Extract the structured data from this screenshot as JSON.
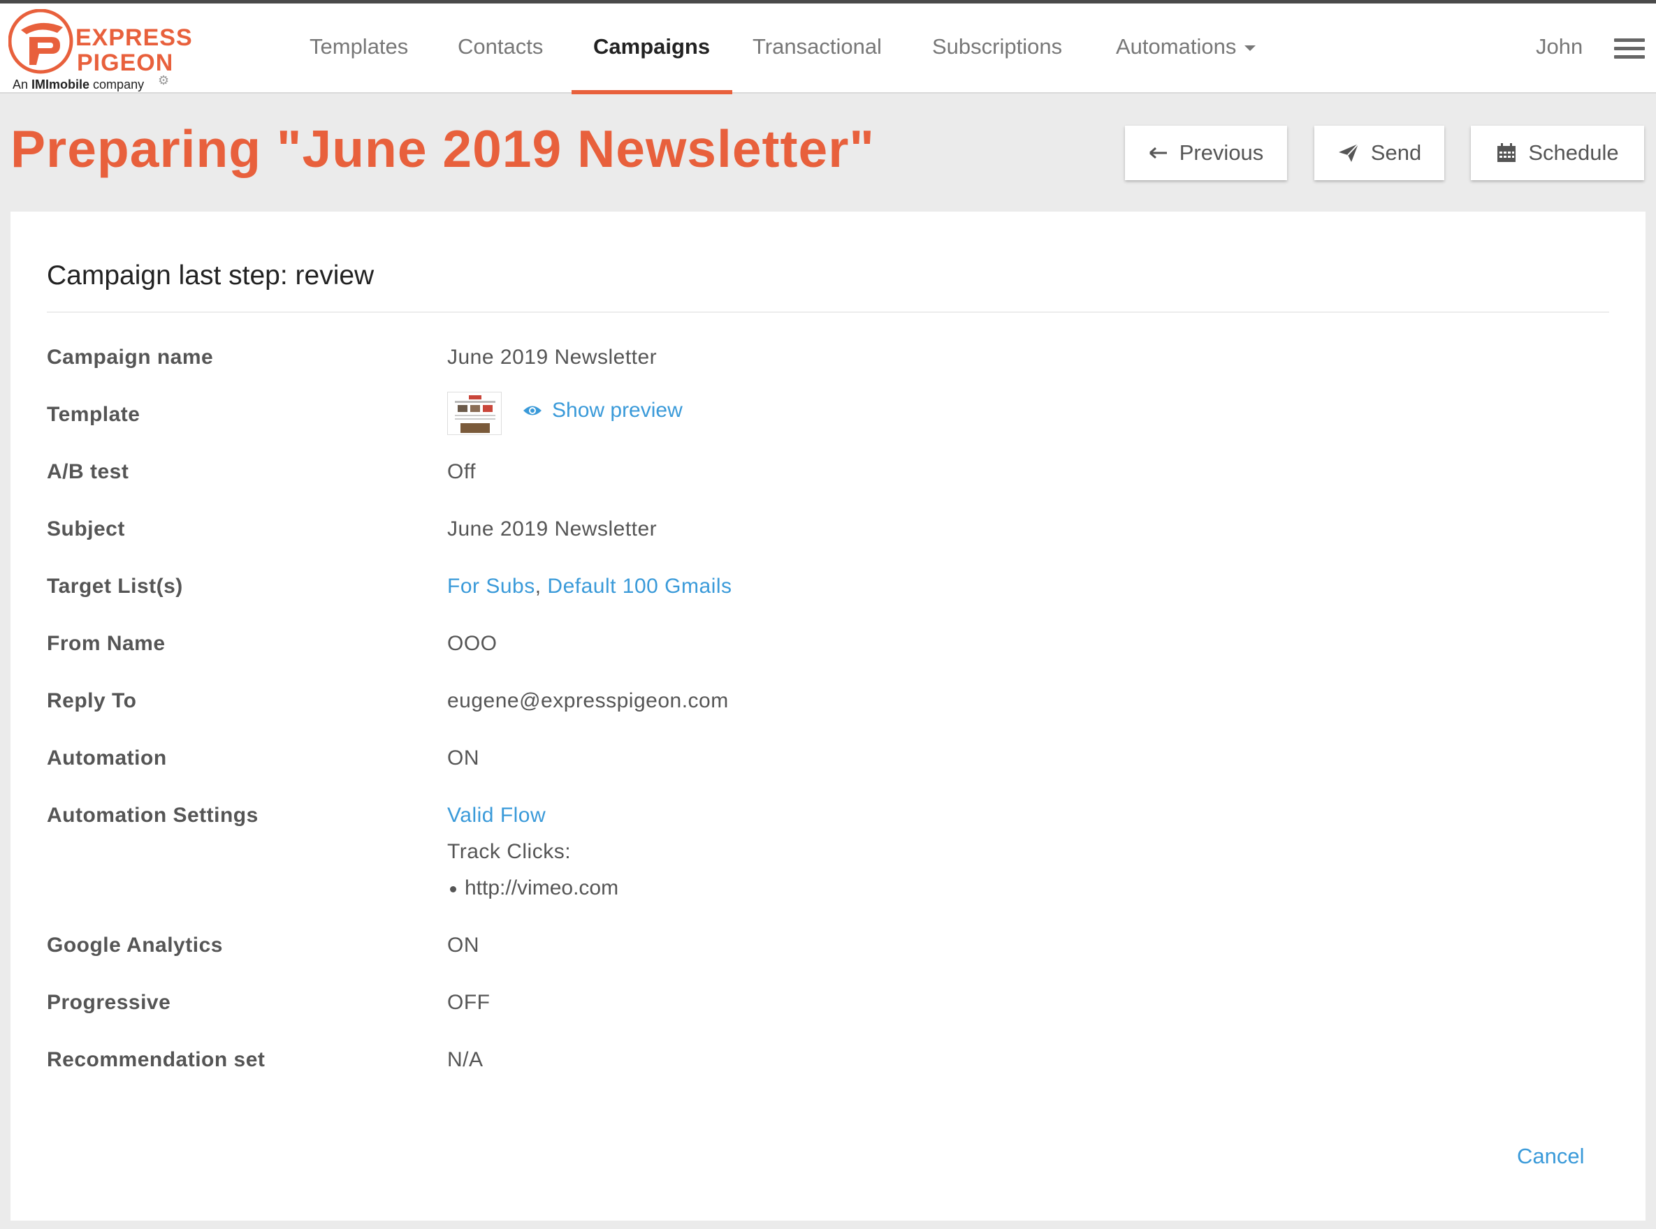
{
  "brand": {
    "word1": "EXPRESS",
    "word2": "PIGEON",
    "sub_prefix": "An ",
    "sub_bold": "IMImobile",
    "sub_suffix": " company",
    "accent_color": "#e8603c",
    "link_color": "#3a9ad9"
  },
  "nav": {
    "items": [
      {
        "label": "Templates"
      },
      {
        "label": "Contacts"
      },
      {
        "label": "Campaigns",
        "active": true
      },
      {
        "label": "Transactional"
      },
      {
        "label": "Subscriptions"
      },
      {
        "label": "Automations",
        "icon": "caret-down-icon"
      }
    ],
    "user": "John",
    "menu_icon": "hamburger-menu-icon"
  },
  "header": {
    "title": "Preparing \"June 2019 Newsletter\"",
    "buttons": {
      "previous": {
        "label": "Previous",
        "icon": "arrow-left-icon"
      },
      "send": {
        "label": "Send",
        "icon": "paper-plane-icon"
      },
      "schedule": {
        "label": "Schedule",
        "icon": "calendar-icon"
      }
    }
  },
  "review": {
    "title": "Campaign last step: review",
    "labels": {
      "campaign_name": "Campaign name",
      "template": "Template",
      "ab_test": "A/B test",
      "subject": "Subject",
      "target_lists": "Target List(s)",
      "from_name": "From Name",
      "reply_to": "Reply To",
      "automation": "Automation",
      "automation_settings": "Automation Settings",
      "google_analytics": "Google Analytics",
      "progressive": "Progressive",
      "recommendation_set": "Recommendation set"
    },
    "values": {
      "campaign_name": "June 2019 Newsletter",
      "template_preview": "Show preview",
      "ab_test": "Off",
      "subject": "June 2019 Newsletter",
      "target_list_1": "For Subs",
      "target_separator": ",",
      "target_list_2": "Default 100 Gmails",
      "from_name": "OOO",
      "reply_to": "eugene@expresspigeon.com",
      "automation": "ON",
      "automation_flow": "Valid Flow",
      "track_clicks_label": "Track Clicks:",
      "track_clicks_urls": [
        "http://vimeo.com"
      ],
      "google_analytics": "ON",
      "progressive": "OFF",
      "recommendation_set": "N/A"
    },
    "cancel_label": "Cancel"
  }
}
